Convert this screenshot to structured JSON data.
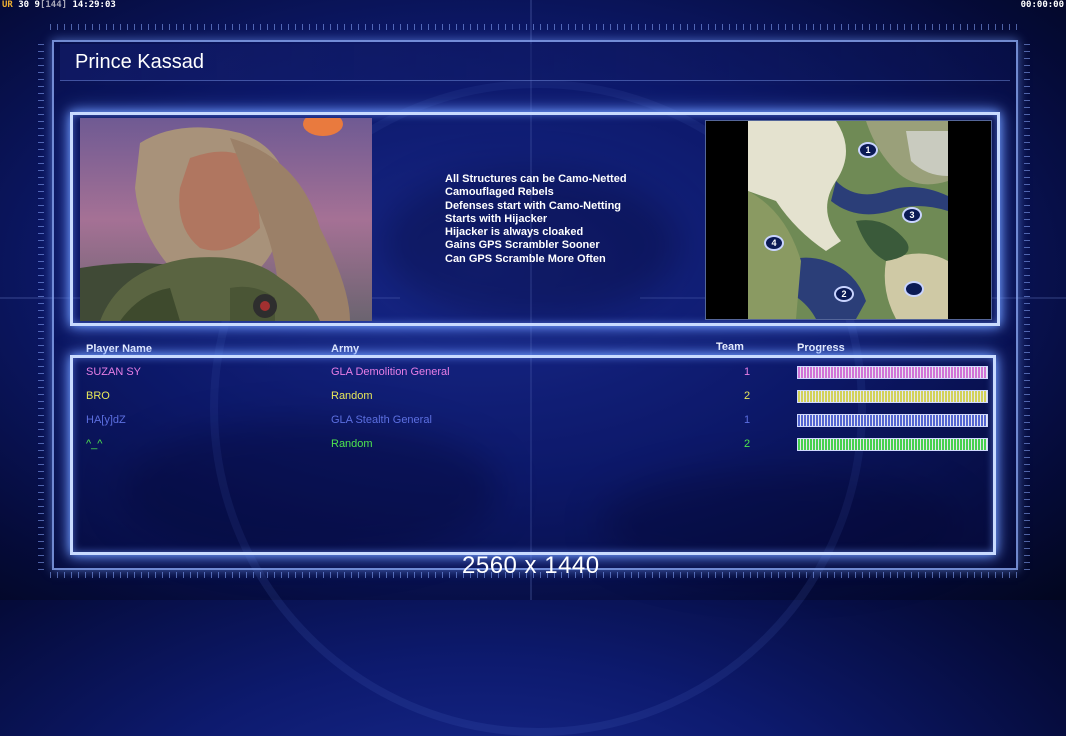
{
  "hud": {
    "left_prefix": "UR",
    "left_stats": "30 9",
    "left_bracket": "[144]",
    "left_time": "14:29:03",
    "right_time": "00:00:00"
  },
  "general": {
    "name": "Prince Kassad",
    "traits": [
      "All Structures can be Camo-Netted",
      "Camouflaged Rebels",
      "Defenses start with Camo-Netting",
      "Starts with Hijacker",
      "Hijacker is always cloaked",
      "Gains GPS Scrambler Sooner",
      "Can GPS Scramble More Often"
    ]
  },
  "map": {
    "start_positions": [
      "1",
      "2",
      "3",
      "4"
    ]
  },
  "table": {
    "headers": {
      "player": "Player Name",
      "army": "Army",
      "team": "Team",
      "progress": "Progress"
    },
    "rows": [
      {
        "player": "SUZAN SY",
        "army": "GLA Demolition General",
        "team": "1",
        "color": "#e77fe6",
        "progress": 1.0
      },
      {
        "player": "BRO",
        "army": "Random",
        "team": "2",
        "color": "#e8e85a",
        "progress": 1.0
      },
      {
        "player": "HA[y]dZ",
        "army": "GLA Stealth General",
        "team": "1",
        "color": "#5c6fe0",
        "progress": 1.0
      },
      {
        "player": "^_^",
        "army": "Random",
        "team": "2",
        "color": "#4ee64e",
        "progress": 1.0
      }
    ]
  },
  "resolution_label": "2560 x 1440"
}
